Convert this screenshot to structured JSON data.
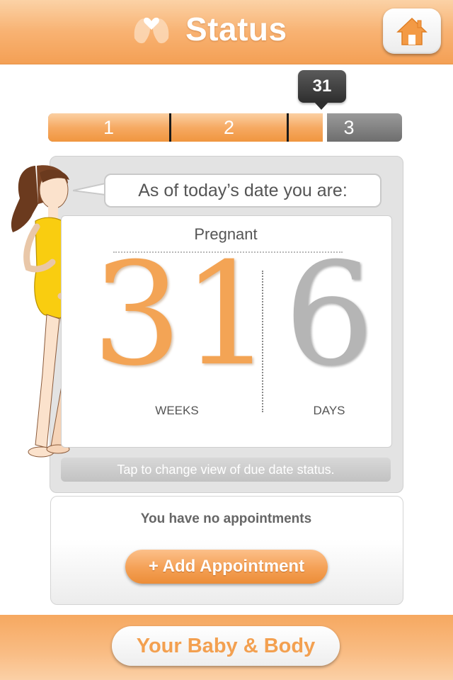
{
  "header": {
    "title": "Status",
    "logo_icon": "hands-heart-icon",
    "home_icon": "home-icon"
  },
  "progress": {
    "current_week": "31",
    "trimesters": [
      "1",
      "2",
      "3"
    ],
    "fill_fraction": 0.775,
    "fill_color": "#f4a055",
    "remaining_color": "#7a7a7a"
  },
  "status": {
    "speech": "As of today’s date you are:",
    "pregnant_label": "Pregnant",
    "weeks_value": "31",
    "weeks_label": "WEEKS",
    "days_value": "6",
    "days_label": "DAYS",
    "tap_hint": "Tap to change view of due date status."
  },
  "appointments": {
    "message": "You have no appointments",
    "add_label": "+ Add Appointment"
  },
  "footer": {
    "button_label": "Your Baby & Body"
  },
  "colors": {
    "accent": "#f4a055",
    "header_top": "#fbd2a6"
  }
}
